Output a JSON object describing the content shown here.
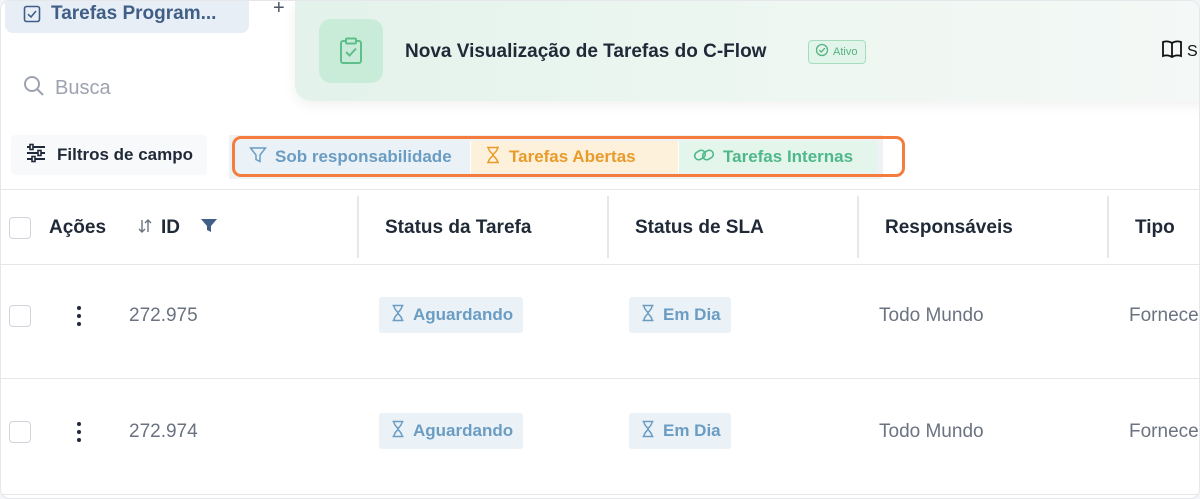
{
  "tabs": {
    "active_label": "Tarefas Program...",
    "add_label": "+"
  },
  "banner": {
    "title": "Nova Visualização de Tarefas do C-Flow",
    "badge": "Ativo",
    "right_label": "S"
  },
  "search": {
    "placeholder": "Busca"
  },
  "filters": {
    "field_filters_label": "Filtros de campo",
    "chips": [
      {
        "label": "Sob responsabilidade",
        "icon": "funnel-icon",
        "color": "#6b9cc2"
      },
      {
        "label": "Tarefas Abertas",
        "icon": "hourglass-icon",
        "color": "#e89b2a"
      },
      {
        "label": "Tarefas Internas",
        "icon": "link-icon",
        "color": "#4fb888"
      }
    ]
  },
  "table": {
    "columns": {
      "actions": "Ações",
      "id": "ID",
      "task_status": "Status da Tarefa",
      "sla_status": "Status de SLA",
      "responsibles": "Responsáveis",
      "type": "Tipo"
    },
    "rows": [
      {
        "id": "272.975",
        "task_status": "Aguardando",
        "sla_status": "Em Dia",
        "responsibles": "Todo Mundo",
        "type": "Fornece"
      },
      {
        "id": "272.974",
        "task_status": "Aguardando",
        "sla_status": "Em Dia",
        "responsibles": "Todo Mundo",
        "type": "Fornece"
      }
    ]
  },
  "colors": {
    "highlight_outline": "#f47c3c",
    "pill_blue": "#6b9cc2",
    "tab_text": "#3f5f86"
  }
}
